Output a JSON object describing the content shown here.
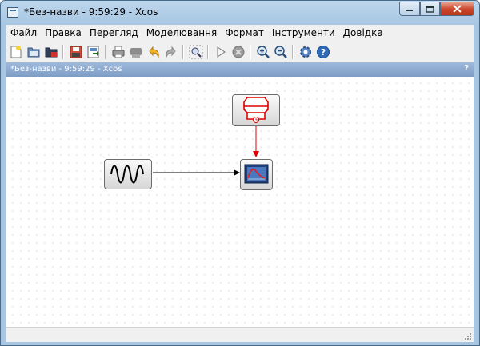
{
  "window": {
    "title": "*Без-назви - 9:59:29 - Xcos"
  },
  "menu": [
    "Файл",
    "Правка",
    "Перегляд",
    "Моделювання",
    "Формат",
    "Інструменти",
    "Довідка"
  ],
  "tab": {
    "title": "*Без-назви - 9:59:29 - Xcos",
    "help": "?"
  },
  "icons": {
    "toolbar": [
      "new-icon",
      "open-icon",
      "open-folder-icon",
      "save-icon",
      "save-as-icon",
      "print-icon",
      "print-disabled-icon",
      "undo-icon",
      "redo-icon",
      "fit-diagram-icon",
      "start-icon",
      "stop-icon",
      "zoom-in-icon",
      "zoom-out-icon",
      "setup-icon",
      "help-icon"
    ]
  },
  "colors": {
    "accent": "#7d9dc6",
    "event_link": "#e00000",
    "regular_link": "#000000"
  }
}
